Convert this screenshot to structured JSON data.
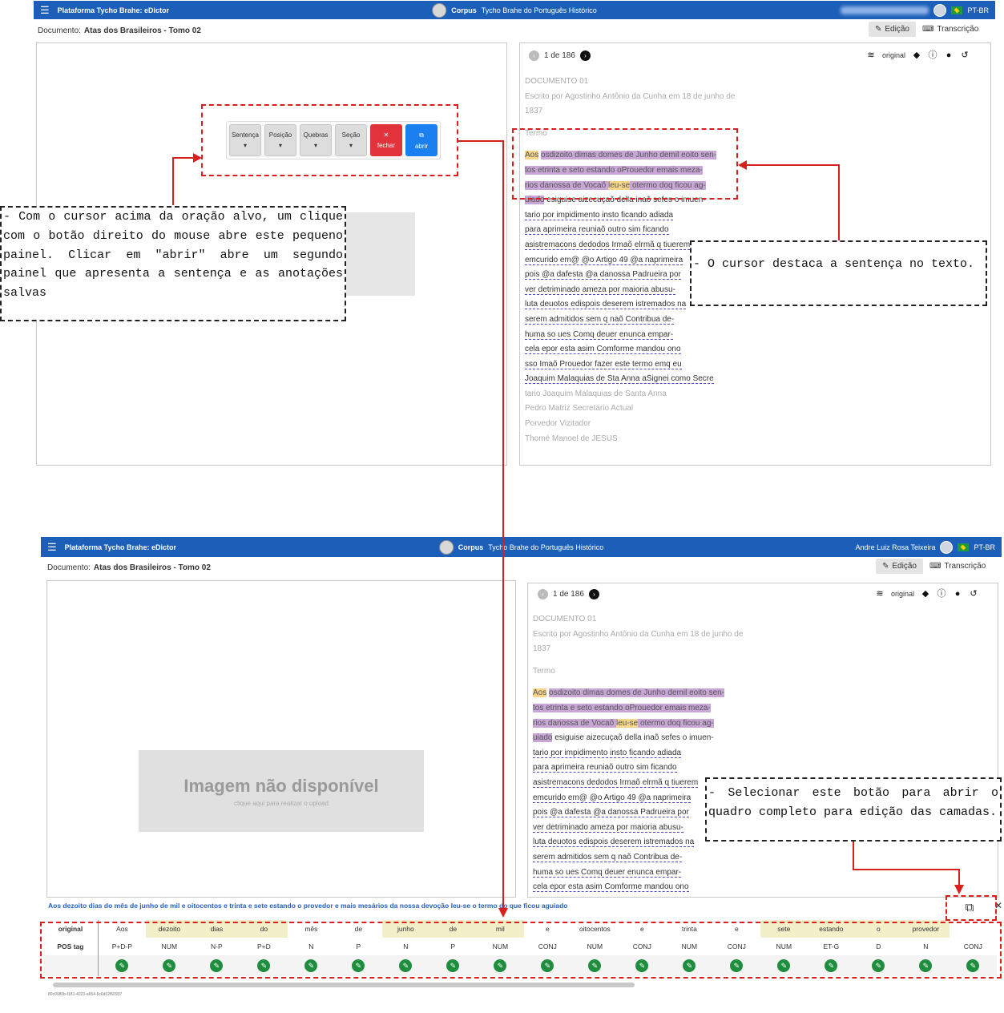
{
  "top": {
    "navbar": {
      "app_title": "Plataforma Tycho Brahe: eDictor",
      "corpus_bold": "Corpus",
      "corpus_rest": "Tycho Brahe do Português Histórico",
      "lang": "PT-BR"
    },
    "doc_label": "Documento:",
    "doc_title": "Atas dos Brasileiros - Tomo 02",
    "tab_edicao": "Edição",
    "tab_transcricao": "Transcrição",
    "pager": "1 de 186",
    "layer": "original",
    "context_menu": {
      "sentenca": "Sentença",
      "posicao": "Posição",
      "quebras": "Quebras",
      "secao": "Seção",
      "fechar": "fechar",
      "abrir": "abrir"
    }
  },
  "bottom": {
    "navbar": {
      "app_title": "Plataforma Tycho Brahe: eDictor",
      "corpus_bold": "Corpus",
      "corpus_rest": "Tycho Brahe do Português Histórico",
      "user": "Andre Luiz Rosa Teixeira",
      "lang": "PT-BR"
    },
    "doc_label": "Documento:",
    "doc_title": "Atas dos Brasileiros - Tomo 02",
    "tab_edicao": "Edição",
    "tab_transcricao": "Transcrição",
    "pager": "1 de 186",
    "layer": "original",
    "noimg_title": "Imagem não disponível",
    "noimg_sub": "clique aqui para realizar o upload",
    "sentence": "Aos dezoito dias do mês de junho de mil e oitocentos e trinta e sete estando o provedor e mais mesários da nossa devoção leu-se o termo do que ficou aguiado",
    "grid_labels": {
      "original": "original",
      "pos": "POS tag"
    },
    "tokens": [
      "Aos",
      "dezoito",
      "dias",
      "do",
      "mês",
      "de",
      "junho",
      "de",
      "mil",
      "e",
      "oitocentos",
      "e",
      "trinta",
      "e",
      "sete",
      "estando",
      "o",
      "provedor"
    ],
    "tags": [
      "P+D-P",
      "NUM",
      "N-P",
      "P+D",
      "N",
      "P",
      "N",
      "P",
      "NUM",
      "CONJ",
      "NUM",
      "CONJ",
      "NUM",
      "CONJ",
      "NUM",
      "ET-G",
      "D",
      "N",
      "CONJ"
    ],
    "footer_id": "80c0980b-f181-4023-a654-6c6d02f60937"
  },
  "doc": {
    "heading": "DOCUMENTO 01",
    "subheading": "Escrito por Agostinho Antônio da Cunha em 18 de junho de 1837",
    "termo": "Termo",
    "lines": [
      "Aos osdizoito dimas domes de Junho demil eoito sen-",
      "tos etrinta e seto estando oProuedor emais meza-",
      "rios danossa de Vocaõ leu-se otermo doq ficou ag-",
      "uiado esiguise aizecuçaõ della inaõ sefes o imuen-",
      "tario por impidimento insto ficando adiada",
      "para aprimeira reuniaõ outro sim ficando",
      "asistremacons dedodos Irmaõ elrmã q tiuerem",
      "emcurido em@ @o Artigo 49 @a naprimeira",
      "pois @a dafesta @a danossa Padrueira por",
      "ver detriminado ameza por maioria abusu-",
      "luta deuotos edispois deserem istremados na",
      "serem admitidos sem q naõ Contribua de-",
      "huma so ues Comq deuer enunca empar-",
      "cela epor esta asim Comforme mandou ono",
      "sso Imaõ Prouedor fazer este termo emq eu",
      "Joaquim Malaquias de Sta Anna aSignei como Secre",
      "tario Joaquim Malaquias de Santa Anna",
      "Pedro Matriz Secretario Actual",
      "Porvedor Vizitador",
      "Thomé Manoel de JESUS"
    ]
  },
  "notes": {
    "n1": "- Com o cursor acima da oração alvo, um clique com o botão direito do mouse abre este pequeno painel. Clicar em \"abrir\" abre um segundo painel que apresenta a sentença e as anotações salvas",
    "n2": "- O cursor destaca a sentença no texto.",
    "n3": "- Selecionar este botão para abrir o quadro completo para edição das camadas."
  }
}
